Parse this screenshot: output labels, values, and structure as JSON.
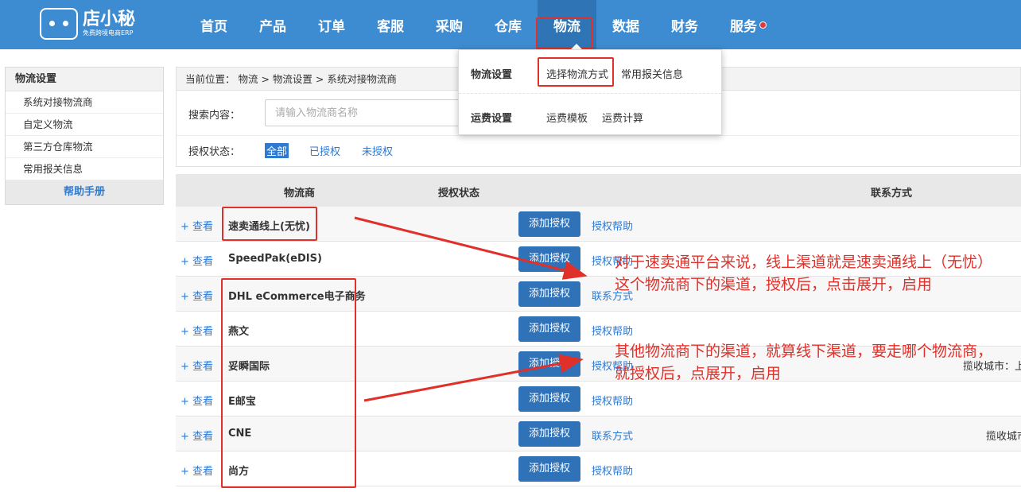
{
  "logo": {
    "name": "店小秘",
    "subtitle": "免费跨境电商ERP"
  },
  "nav": [
    {
      "label": "首页"
    },
    {
      "label": "产品"
    },
    {
      "label": "订单"
    },
    {
      "label": "客服"
    },
    {
      "label": "采购"
    },
    {
      "label": "仓库"
    },
    {
      "label": "物流"
    },
    {
      "label": "数据"
    },
    {
      "label": "财务"
    },
    {
      "label": "服务"
    }
  ],
  "sidebar": {
    "title": "物流设置",
    "items": [
      {
        "label": "系统对接物流商"
      },
      {
        "label": "自定义物流"
      },
      {
        "label": "第三方仓库物流"
      },
      {
        "label": "常用报关信息"
      }
    ],
    "help": "帮助手册"
  },
  "breadcrumb": "当前位置： 物流 > 物流设置 > 系统对接物流商",
  "filter": {
    "search_label": "搜索内容：",
    "search_placeholder": "请输入物流商名称",
    "auth_label": "授权状态：",
    "auth_options": [
      "全部",
      "已授权",
      "未授权"
    ]
  },
  "dropdown": {
    "row1": {
      "heading": "物流设置",
      "links": [
        "选择物流方式",
        "常用报关信息"
      ]
    },
    "row2": {
      "heading": "运费设置",
      "links": [
        "运费模板",
        "运费计算"
      ]
    }
  },
  "table": {
    "headers": {
      "provider": "物流商",
      "auth": "授权状态",
      "contact": "联系方式"
    },
    "view_label": "+ 查看",
    "add_label": "添加授权",
    "rows": [
      {
        "name": "速卖通线上(无忧)",
        "link": "授权帮助",
        "contact": ""
      },
      {
        "name": "SpeedPak(eDIS)",
        "link": "授权帮助",
        "contact": ""
      },
      {
        "name": "DHL eCommerce电子商务",
        "link": "联系方式",
        "contact": ""
      },
      {
        "name": "燕文",
        "link": "授权帮助",
        "contact": ""
      },
      {
        "name": "妥瞬国际",
        "link": "授权帮助",
        "contact": "揽收城市：上"
      },
      {
        "name": "E邮宝",
        "link": "授权帮助",
        "contact": ""
      },
      {
        "name": "CNE",
        "link": "联系方式",
        "contact": "揽收城市"
      },
      {
        "name": "尚方",
        "link": "授权帮助",
        "contact": ""
      }
    ]
  },
  "annotations": {
    "note1": "对于速卖通平台来说，线上渠道就是速卖通线上（无忧）这个物流商下的渠道，授权后，点击展开，启用",
    "note2": "其他物流商下的渠道，就算线下渠道，要走哪个物流商，就授权后，点展开，启用"
  },
  "colors": {
    "topbar": "#3d8bd0",
    "accent": "#2f72b8",
    "link": "#2f7ad0",
    "annotation": "#e0302a"
  }
}
